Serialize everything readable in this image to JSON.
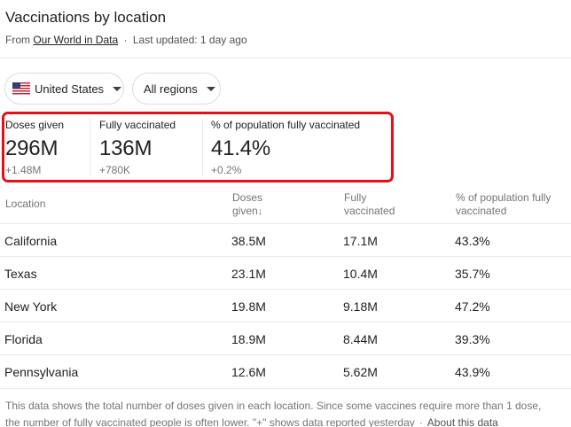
{
  "header": {
    "title": "Vaccinations by location",
    "source_prefix": "From",
    "source_link": "Our World in Data",
    "separator": "·",
    "updated": "Last updated: 1 day ago"
  },
  "filters": {
    "region": {
      "label": "United States",
      "icon": "us-flag-icon"
    },
    "area": {
      "label": "All regions"
    }
  },
  "stats": [
    {
      "label": "Doses given",
      "value": "296M",
      "delta": "+1.48M"
    },
    {
      "label": "Fully vaccinated",
      "value": "136M",
      "delta": "+780K"
    },
    {
      "label": "% of population fully vaccinated",
      "value": "41.4%",
      "delta": "+0.2%"
    }
  ],
  "table": {
    "headers": {
      "location": "Location",
      "doses_1": "Doses",
      "doses_2": "given",
      "doses_sort_icon": "↓",
      "fully_1": "Fully",
      "fully_2": "vaccinated",
      "pct_1": "% of population fully",
      "pct_2": "vaccinated"
    },
    "rows": [
      [
        "California",
        "38.5M",
        "17.1M",
        "43.3%"
      ],
      [
        "Texas",
        "23.1M",
        "10.4M",
        "35.7%"
      ],
      [
        "New York",
        "19.8M",
        "9.18M",
        "47.2%"
      ],
      [
        "Florida",
        "18.9M",
        "8.44M",
        "39.3%"
      ],
      [
        "Pennsylvania",
        "12.6M",
        "5.62M",
        "43.9%"
      ]
    ]
  },
  "footer": {
    "line1": "This data shows the total number of doses given in each location. Since some vaccines require more than 1 dose,",
    "line2": "the number of fully vaccinated people is often lower. \"+\" shows data reported yesterday",
    "separator": "·",
    "about_link": "About this data"
  },
  "colors": {
    "highlight": "#e3101a",
    "text": "#202124",
    "muted": "#70757a",
    "divider": "#e8eaed"
  }
}
